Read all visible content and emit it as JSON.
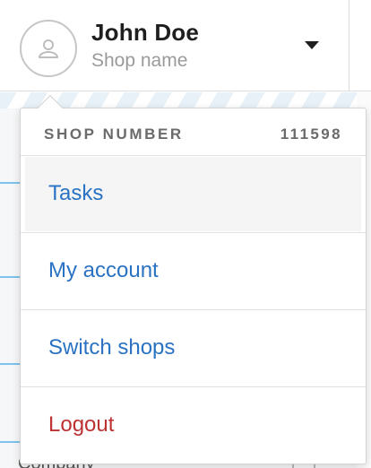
{
  "header": {
    "user_name": "John Doe",
    "shop_name": "Shop name",
    "avatar_icon": "user-icon",
    "toggle_icon": "caret-down-icon"
  },
  "background": {
    "partial_text": "Company"
  },
  "dropdown": {
    "shop_number_label": "SHOP NUMBER",
    "shop_number_value": "111598",
    "items": [
      {
        "label": "Tasks",
        "active": true
      },
      {
        "label": "My account"
      },
      {
        "label": "Switch shops"
      },
      {
        "label": "Logout",
        "danger": true
      }
    ]
  },
  "colors": {
    "link": "#2a72c2",
    "danger": "#bd3232",
    "muted": "#9a9a9a",
    "accent_line": "#7ec2ea"
  }
}
